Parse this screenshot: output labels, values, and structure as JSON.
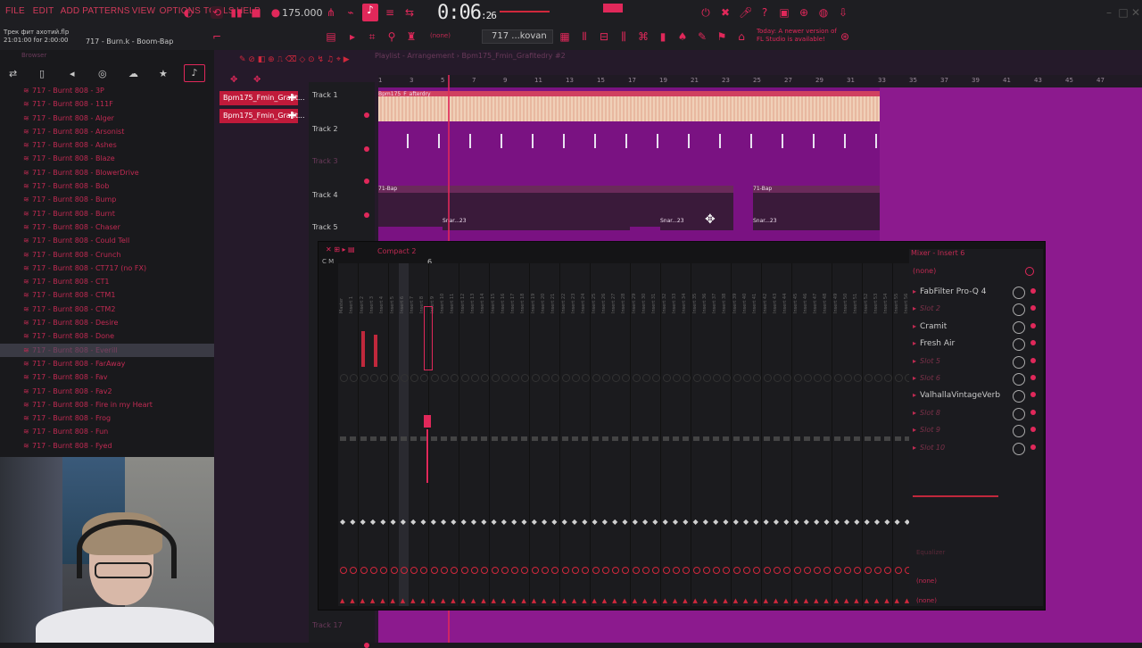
{
  "menu": [
    "FILE",
    "EDIT",
    "ADD",
    "PATTERNS",
    "VIEW",
    "OPTIONS",
    "TOOLS",
    "HELP"
  ],
  "transport": {
    "bpm": "175.000",
    "time": "0:06",
    "time_small": ":26"
  },
  "project": {
    "line1": "Трек фит ахотий.flp",
    "line2": "21:01:00 for 2:00:00"
  },
  "hint_text": "717 - Burn.k - Boom-Bap",
  "pattern_selector": "717 ...kovan",
  "news": {
    "line1": "Today: A newer version of",
    "line2": "FL Studio is available!"
  },
  "playlist": {
    "title": "Playlist - Arrangement › Bpm175_Fmin_Grafitedry #2",
    "clips": [
      "Bpm175_Fmin_Grafit...",
      "Bpm175_Fmin_Grafit..."
    ],
    "tracks": [
      {
        "label": "Track 1"
      },
      {
        "label": "Track 2"
      },
      {
        "label": "Track 3"
      },
      {
        "label": "Track 4"
      },
      {
        "label": "Track 5"
      },
      {
        "label": "Track 17"
      }
    ],
    "ruler": [
      "1",
      "3",
      "5",
      "7",
      "9",
      "11",
      "13",
      "15",
      "17",
      "19",
      "21",
      "23",
      "25",
      "27",
      "29",
      "31",
      "33",
      "35",
      "37",
      "39",
      "41",
      "43",
      "45",
      "47"
    ],
    "t1_clip": "Bpm175_F_afterdry",
    "t4_clip": "71-Bap",
    "t5_clip": "Snar...23"
  },
  "browser": {
    "title": "Browser",
    "items": [
      "717 - Burnt 808 - 3P",
      "717 - Burnt 808 - 111F",
      "717 - Burnt 808 - Alger",
      "717 - Burnt 808 - Arsonist",
      "717 - Burnt 808 - Ashes",
      "717 - Burnt 808 - Blaze",
      "717 - Burnt 808 - BlowerDrive",
      "717 - Burnt 808 - Bob",
      "717 - Burnt 808 - Bump",
      "717 - Burnt 808 - Burnt",
      "717 - Burnt 808 - Chaser",
      "717 - Burnt 808 - Could Tell",
      "717 - Burnt 808 - Crunch",
      "717 - Burnt 808 - CT717 (no FX)",
      "717 - Burnt 808 - CT1",
      "717 - Burnt 808 - CTM1",
      "717 - Burnt 808 - CTM2",
      "717 - Burnt 808 - Desire",
      "717 - Burnt 808 - Done",
      "717 - Burnt 808 - Everill",
      "717 - Burnt 808 - FarAway",
      "717 - Burnt 808 - Fav",
      "717 - Burnt 808 - Fav2",
      "717 - Burnt 808 - Fire in my Heart",
      "717 - Burnt 808 - Frog",
      "717 - Burnt 808 - Fun",
      "717 - Burnt 808 - Fyed"
    ],
    "selected_index": 19
  },
  "mixer": {
    "title": "Compact 2",
    "strips": [
      "Master",
      "Insert 1",
      "Insert 2",
      "Insert 3",
      "Insert 4",
      "Insert 5",
      "Insert 6",
      "Insert 7",
      "Insert 8",
      "Insert 9",
      "Insert 10",
      "Insert 11",
      "Insert 12",
      "Insert 13",
      "Insert 14",
      "Insert 15",
      "Insert 16",
      "Insert 17",
      "Insert 18",
      "Insert 19",
      "Insert 20",
      "Insert 21",
      "Insert 22",
      "Insert 23",
      "Insert 24",
      "Insert 25",
      "Insert 26",
      "Insert 27",
      "Insert 28",
      "Insert 29",
      "Insert 30",
      "Insert 31",
      "Insert 32",
      "Insert 33",
      "Insert 34",
      "Insert 35",
      "Insert 36",
      "Insert 37",
      "Insert 38",
      "Insert 39",
      "Insert 40",
      "Insert 41",
      "Insert 42",
      "Insert 43",
      "Insert 44",
      "Insert 45",
      "Insert 46",
      "Insert 47",
      "Insert 48",
      "Insert 49",
      "Insert 50",
      "Insert 51",
      "Insert 52",
      "Insert 53",
      "Insert 54",
      "Insert 55",
      "Insert 56"
    ],
    "selected_strip": 6,
    "selected_strip_label": "6"
  },
  "insert_panel": {
    "title": "Mixer - Insert 6",
    "dropdown": "(none)",
    "slots": [
      {
        "name": "FabFilter Pro-Q 4",
        "empty": false
      },
      {
        "name": "Slot 2",
        "empty": true
      },
      {
        "name": "Cramit",
        "empty": false
      },
      {
        "name": "Fresh Air",
        "empty": false
      },
      {
        "name": "Slot 5",
        "empty": true
      },
      {
        "name": "Slot 6",
        "empty": true
      },
      {
        "name": "ValhallaVintageVerb",
        "empty": false
      },
      {
        "name": "Slot 8",
        "empty": true
      },
      {
        "name": "Slot 9",
        "empty": true
      },
      {
        "name": "Slot 10",
        "empty": true
      }
    ],
    "eq_label": "Equalizer",
    "send1": "(none)",
    "send2": "(none)"
  },
  "colors": {
    "accent": "#e0285a",
    "playlist_bg": "#8c1a8e"
  }
}
